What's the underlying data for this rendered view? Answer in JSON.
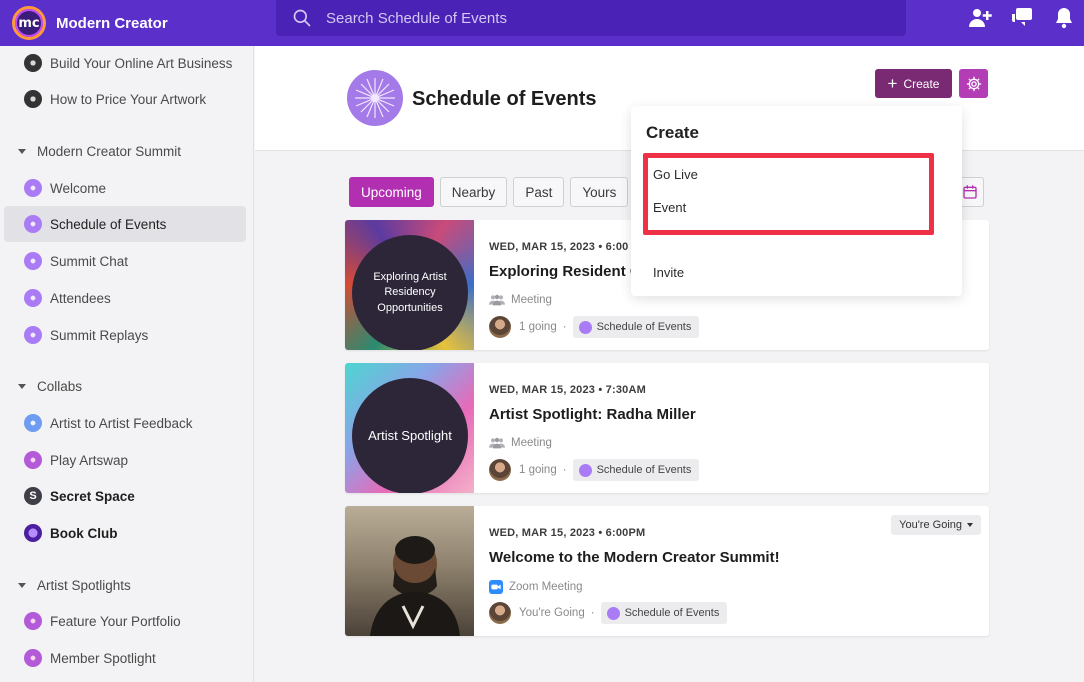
{
  "brand": {
    "logo_text": "mc",
    "name": "Modern Creator"
  },
  "search": {
    "placeholder": "Search Schedule of Events"
  },
  "sidebar": {
    "items_top": [
      {
        "label": "Build Your Online Art Business",
        "icon": "space-icon-dark"
      },
      {
        "label": "How to Price Your Artwork",
        "icon": "space-icon-dark"
      }
    ],
    "groups": [
      {
        "label": "Modern Creator Summit",
        "items": [
          {
            "label": "Welcome"
          },
          {
            "label": "Schedule of Events",
            "active": true
          },
          {
            "label": "Summit Chat"
          },
          {
            "label": "Attendees"
          },
          {
            "label": "Summit Replays"
          }
        ]
      },
      {
        "label": "Collabs",
        "items": [
          {
            "label": "Artist to Artist Feedback"
          },
          {
            "label": "Play Artswap"
          },
          {
            "label": "Secret Space",
            "badge": "S"
          },
          {
            "label": "Book Club"
          }
        ]
      },
      {
        "label": "Artist Spotlights",
        "items": [
          {
            "label": "Feature Your Portfolio"
          },
          {
            "label": "Member Spotlight"
          }
        ]
      }
    ]
  },
  "page": {
    "title": "Schedule of Events"
  },
  "toolbar": {
    "create_label": "Create"
  },
  "tabs": [
    {
      "label": "Upcoming",
      "active": true
    },
    {
      "label": "Nearby"
    },
    {
      "label": "Past"
    },
    {
      "label": "Yours"
    }
  ],
  "events": [
    {
      "image_text": "Exploring Artist Residency Opportunities",
      "date": "WED, MAR 15, 2023 • 6:00",
      "title": "Exploring Resident C",
      "type": "Meeting",
      "attendance": "1 going",
      "space": "Schedule of Events"
    },
    {
      "image_text": "Artist Spotlight",
      "date": "WED, MAR 15, 2023 • 7:30AM",
      "title": "Artist Spotlight: Radha Miller",
      "type": "Meeting",
      "attendance": "1 going",
      "space": "Schedule of Events"
    },
    {
      "date": "WED, MAR 15, 2023 • 6:00PM",
      "title": "Welcome to the Modern Creator Summit!",
      "type": "Zoom Meeting",
      "attendance": "You're Going",
      "space": "Schedule of Events",
      "rsvp": "You're Going"
    }
  ],
  "create_menu": {
    "title": "Create",
    "items": [
      "Go Live",
      "Event",
      "Invite"
    ]
  },
  "colors": {
    "topbar": "#5b2fc9",
    "create_button": "#7a2a73",
    "tab_active": "#b32fb2",
    "highlight": "#ef3147"
  }
}
